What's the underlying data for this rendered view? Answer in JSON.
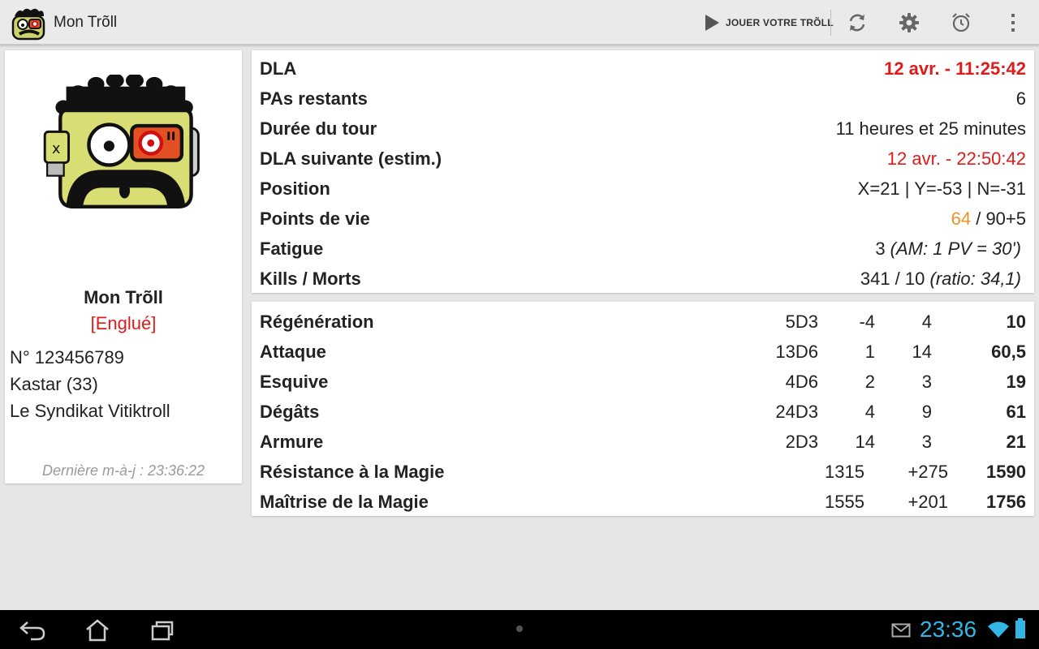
{
  "app": {
    "title": "Mon Trõll",
    "play_label": "JOUER VOTRE TRÕLL",
    "icons": [
      "refresh-icon",
      "gear-icon",
      "alarm-icon",
      "overflow-menu-icon"
    ]
  },
  "profile": {
    "name": "Mon Trõll",
    "status": "[Englué]",
    "number": "N° 123456789",
    "race": "Kastar (33)",
    "guild": "Le Syndikat Vitiktroll",
    "last_update": "Dernière m-à-j : 23:36:22"
  },
  "info": {
    "dla_label": "DLA",
    "dla_value": "12 avr. - 11:25:42",
    "pas_label": "PAs restants",
    "pas_value": "6",
    "duree_label": "Durée du tour",
    "duree_value": "11 heures et 25 minutes",
    "dla_next_label": "DLA suivante (estim.)",
    "dla_next_value": "12 avr. - 22:50:42",
    "position_label": "Position",
    "position_value": "X=21 | Y=-53 | N=-31",
    "pv_label": "Points de vie",
    "pv_current": "64",
    "pv_max": " / 90+5",
    "fatigue_label": "Fatigue",
    "fatigue_value": "3 ",
    "fatigue_note": "(AM: 1 PV = 30')",
    "kills_label": "Kills / Morts",
    "kills_value": "341 / 10 ",
    "kills_note": "(ratio: 34,1)"
  },
  "stats": [
    {
      "label": "Régénération",
      "dice": "5D3",
      "bonus": "-4",
      "mod": "4",
      "total": "10"
    },
    {
      "label": "Attaque",
      "dice": "13D6",
      "bonus": "1",
      "mod": "14",
      "total": "60,5"
    },
    {
      "label": "Esquive",
      "dice": "4D6",
      "bonus": "2",
      "mod": "3",
      "total": "19"
    },
    {
      "label": "Dégâts",
      "dice": "24D3",
      "bonus": "4",
      "mod": "9",
      "total": "61"
    },
    {
      "label": "Armure",
      "dice": "2D3",
      "bonus": "14",
      "mod": "3",
      "total": "21"
    }
  ],
  "magic": [
    {
      "label": "Résistance à la Magie",
      "base": "1315",
      "bonus": "+275",
      "total": "1590"
    },
    {
      "label": "Maîtrise de la Magie",
      "base": "1555",
      "bonus": "+201",
      "total": "1756"
    }
  ],
  "system": {
    "time": "23:36",
    "accent": "#33b5e5"
  }
}
